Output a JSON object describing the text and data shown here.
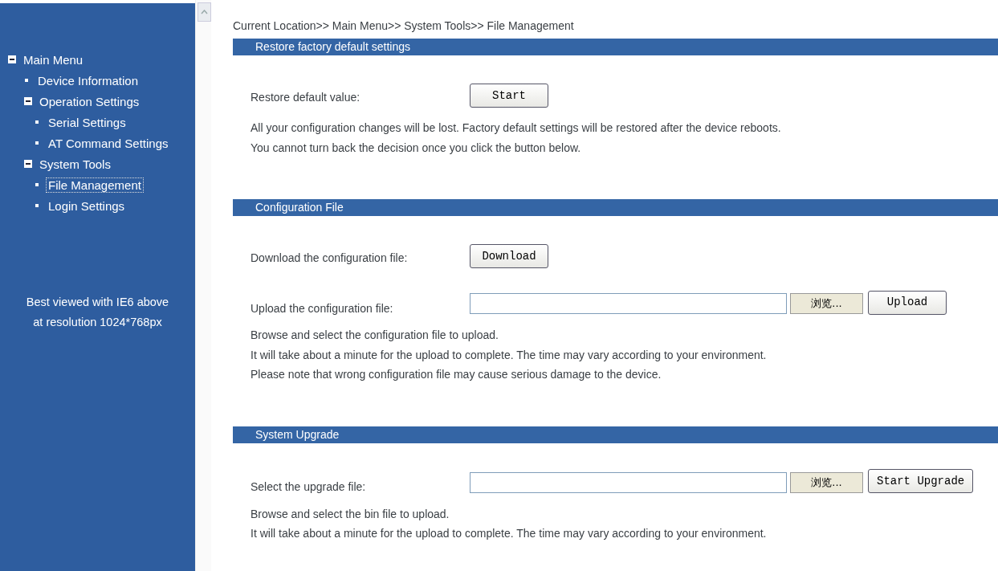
{
  "sidebar": {
    "tree": [
      {
        "label": "Main Menu",
        "expanded": true,
        "selected": false,
        "children": [
          {
            "label": "Device Information",
            "selected": false
          },
          {
            "label": "Operation Settings",
            "expanded": true,
            "selected": false,
            "children": [
              {
                "label": "Serial Settings",
                "selected": false
              },
              {
                "label": "AT Command Settings",
                "selected": false
              }
            ]
          },
          {
            "label": "System Tools",
            "expanded": true,
            "selected": false,
            "children": [
              {
                "label": "File Management",
                "selected": true
              },
              {
                "label": "Login Settings",
                "selected": false
              }
            ]
          }
        ]
      }
    ],
    "note": [
      "Best viewed with IE6 above",
      "at resolution 1024*768px"
    ]
  },
  "breadcrumb": "Current Location>> Main Menu>> System Tools>> File Management",
  "sections": [
    {
      "title": "Restore factory default settings",
      "rows": [
        {
          "kind": "button",
          "label": "Restore default value:",
          "button": "Start"
        }
      ],
      "notes": [
        "All your configuration changes will be lost. Factory default settings will be restored after the device reboots.",
        "You cannot turn back the decision once you click the button below."
      ]
    },
    {
      "title": "Configuration File",
      "rows": [
        {
          "kind": "button",
          "label": "Download the configuration file:",
          "button": "Download"
        },
        {
          "kind": "file",
          "label": "Upload the configuration file:",
          "browse": "浏览...",
          "button": "Upload"
        }
      ],
      "notes": [
        "Browse and select the configuration file to upload.",
        "It will take about a minute for the upload to complete. The time may vary according to your environment.",
        "Please note that wrong configuration file may cause serious damage to the device."
      ]
    },
    {
      "title": "System Upgrade",
      "rows": [
        {
          "kind": "file",
          "label": "Select the upgrade file:",
          "browse": "浏览...",
          "button": "Start Upgrade"
        }
      ],
      "notes": [
        "Browse and select the bin file to upload.",
        "It will take about a minute for the upload to complete. The time may vary according to your environment."
      ]
    }
  ]
}
